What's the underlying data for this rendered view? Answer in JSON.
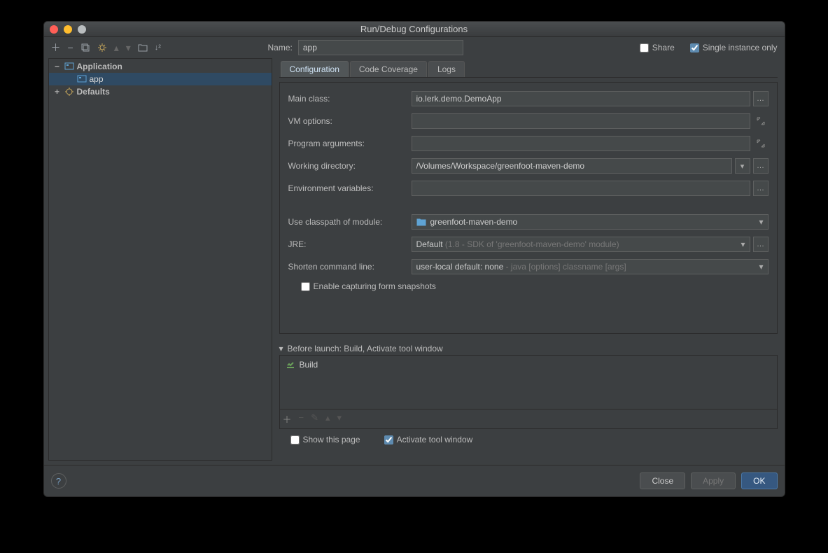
{
  "window_title": "Run/Debug Configurations",
  "name_label": "Name:",
  "name_value": "app",
  "share_label": "Share",
  "share_checked": false,
  "single_instance_label": "Single instance only",
  "single_instance_checked": true,
  "tree": {
    "application_label": "Application",
    "app_label": "app",
    "defaults_label": "Defaults"
  },
  "tabs": {
    "configuration": "Configuration",
    "code_coverage": "Code Coverage",
    "logs": "Logs"
  },
  "form": {
    "main_class_label": "Main class:",
    "main_class_value": "io.lerk.demo.DemoApp",
    "vm_options_label": "VM options:",
    "vm_options_value": "",
    "program_args_label": "Program arguments:",
    "program_args_value": "",
    "working_dir_label": "Working directory:",
    "working_dir_value": "/Volumes/Workspace/greenfoot-maven-demo",
    "env_vars_label": "Environment variables:",
    "env_vars_value": "",
    "classpath_label": "Use classpath of module:",
    "classpath_value": "greenfoot-maven-demo",
    "jre_label": "JRE:",
    "jre_value": "Default",
    "jre_hint": " (1.8 - SDK of 'greenfoot-maven-demo' module)",
    "shorten_label": "Shorten command line:",
    "shorten_value": "user-local default: none",
    "shorten_hint": " - java [options] classname [args]",
    "snapshots_label": "Enable capturing form snapshots",
    "snapshots_checked": false
  },
  "before_launch": {
    "header": "Before launch: Build, Activate tool window",
    "items": [
      "Build"
    ],
    "show_this_page_label": "Show this page",
    "show_this_page_checked": false,
    "activate_tool_label": "Activate tool window",
    "activate_tool_checked": true
  },
  "buttons": {
    "close": "Close",
    "apply": "Apply",
    "ok": "OK"
  }
}
